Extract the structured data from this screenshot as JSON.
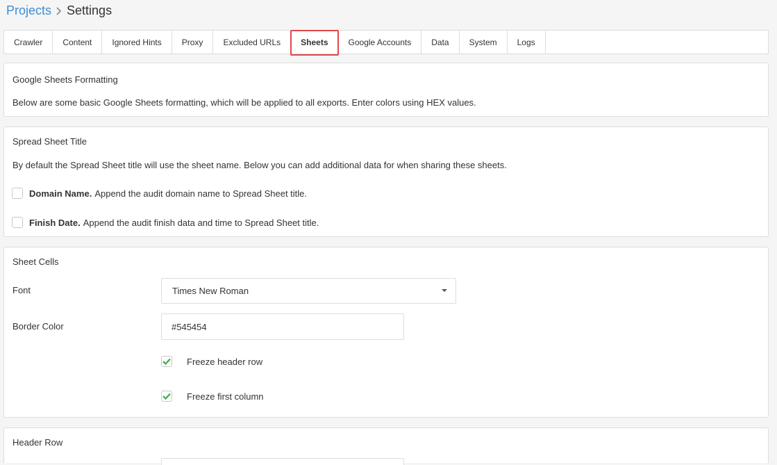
{
  "breadcrumb": {
    "parent": "Projects",
    "current": "Settings"
  },
  "tabs": [
    {
      "label": "Crawler"
    },
    {
      "label": "Content"
    },
    {
      "label": "Ignored Hints"
    },
    {
      "label": "Proxy"
    },
    {
      "label": "Excluded URLs"
    },
    {
      "label": "Sheets",
      "active": true
    },
    {
      "label": "Google Accounts"
    },
    {
      "label": "Data"
    },
    {
      "label": "System"
    },
    {
      "label": "Logs"
    }
  ],
  "formatting": {
    "title": "Google Sheets Formatting",
    "description": "Below are some basic Google Sheets formatting, which will be applied to all exports. Enter colors using HEX values."
  },
  "spreadsheet_title": {
    "title": "Spread Sheet Title",
    "description": "By default the Spread Sheet title will use the sheet name. Below you can add additional data for when sharing these sheets.",
    "domain_name": {
      "label": "Domain Name.",
      "text": "Append the audit domain name to Spread Sheet title.",
      "checked": false
    },
    "finish_date": {
      "label": "Finish Date.",
      "text": "Append the audit finish data and time to Spread Sheet title.",
      "checked": false
    }
  },
  "sheet_cells": {
    "title": "Sheet Cells",
    "font_label": "Font",
    "font_value": "Times New Roman",
    "border_label": "Border Color",
    "border_value": "#545454",
    "freeze_header": {
      "label": "Freeze header row",
      "checked": true
    },
    "freeze_column": {
      "label": "Freeze first column",
      "checked": true
    }
  },
  "header_row": {
    "title": "Header Row"
  },
  "colors": {
    "link": "#3d8fd6",
    "active_tab_outline": "#e0484d",
    "check": "#4caf50"
  }
}
